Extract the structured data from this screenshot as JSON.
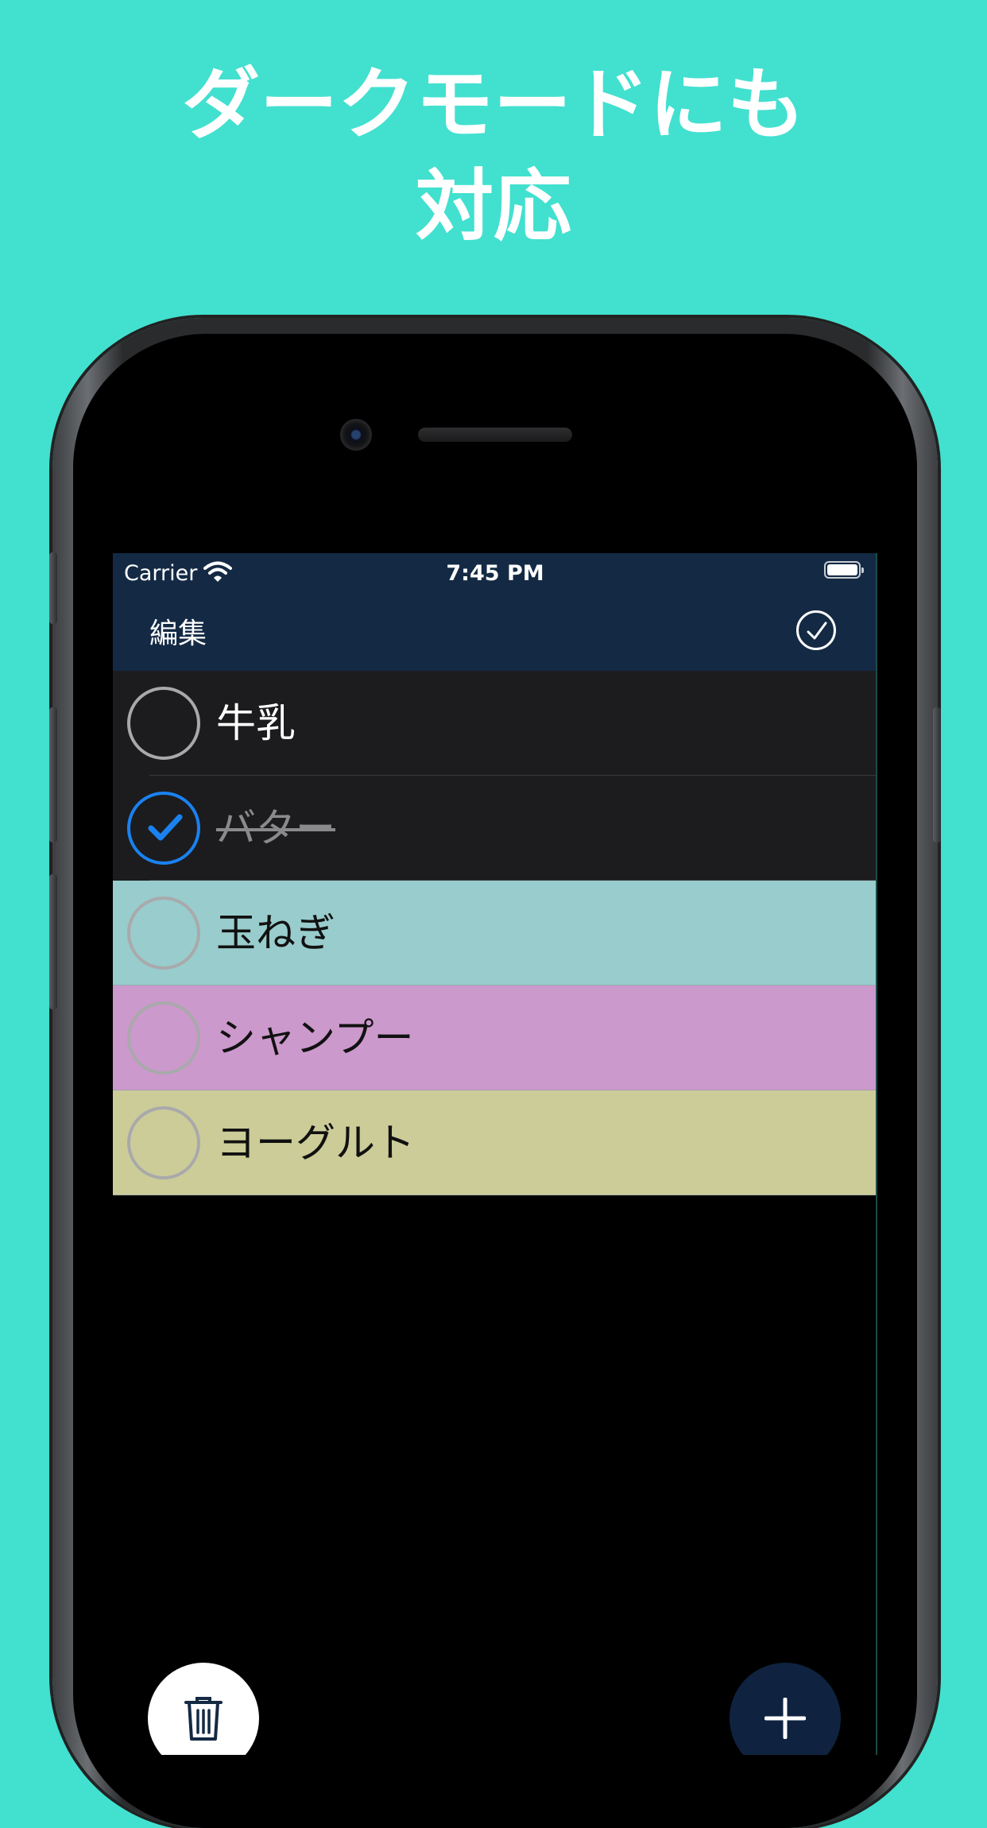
{
  "headline": {
    "line1": "ダークモードにも",
    "line2": "対応"
  },
  "status_bar": {
    "carrier": "Carrier",
    "time": "7:45 PM"
  },
  "navbar": {
    "edit_label": "編集"
  },
  "items": [
    {
      "label": "牛乳",
      "checked": false,
      "color": "#1c1c1e",
      "text_color": "#ffffff"
    },
    {
      "label": "バター",
      "checked": true,
      "color": "#1c1c1e",
      "text_color": "#8a8a8d"
    },
    {
      "label": "玉ねぎ",
      "checked": false,
      "color": "#99cccc",
      "text_color": "#111111"
    },
    {
      "label": "シャンプー",
      "checked": false,
      "color": "#cc99cc",
      "text_color": "#111111"
    },
    {
      "label": "ヨーグルト",
      "checked": false,
      "color": "#cccc99",
      "text_color": "#111111"
    }
  ],
  "icons": {
    "camera": "camera-icon",
    "wifi": "wifi-icon",
    "battery": "battery-icon",
    "complete": "check-circle-icon",
    "delete": "trash-icon",
    "add": "plus-icon"
  },
  "colors": {
    "background": "#42e0cf",
    "navbar": "#142a44",
    "check_accent": "#1a82f0",
    "add_button": "#0f2340"
  }
}
